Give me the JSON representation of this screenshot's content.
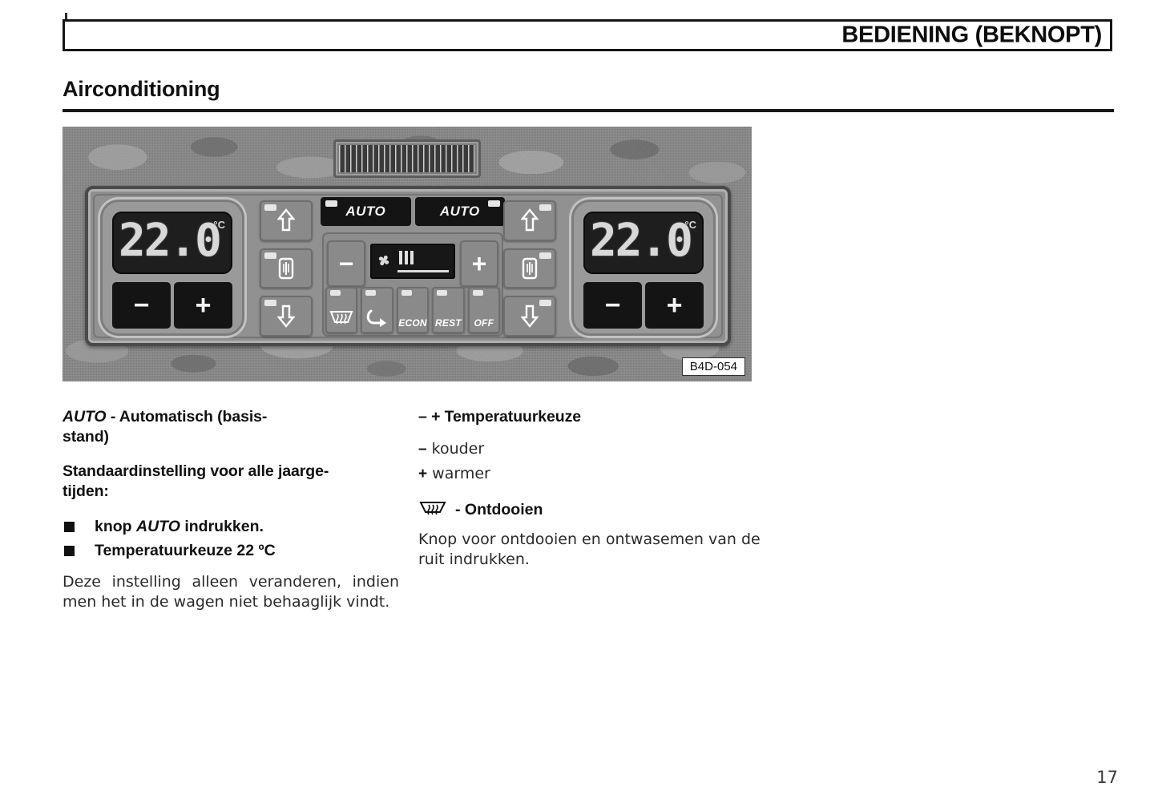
{
  "header": {
    "title": "BEDIENING (BEKNOPT)"
  },
  "section": {
    "title": "Airconditioning"
  },
  "figure": {
    "code": "B4D-054",
    "caption_code_label": "B4D-054",
    "panel": {
      "left_display": {
        "temperature": "22.0",
        "unit": "°C"
      },
      "right_display": {
        "temperature": "22.0",
        "unit": "°C"
      },
      "left_minus": "−",
      "left_plus": "+",
      "right_minus": "−",
      "right_plus": "+",
      "auto_left": "AUTO",
      "auto_right": "AUTO",
      "fan_minus": "−",
      "fan_plus": "+",
      "fan_level_bars": 3,
      "function_buttons": [
        {
          "name": "defrost",
          "label": ""
        },
        {
          "name": "recirculate",
          "label": ""
        },
        {
          "name": "econ",
          "label": "ECON"
        },
        {
          "name": "rest",
          "label": "REST"
        },
        {
          "name": "off",
          "label": "OFF"
        }
      ],
      "airflow_buttons": [
        {
          "name": "upper-vent",
          "label": ""
        },
        {
          "name": "middle-vent",
          "label": ""
        },
        {
          "name": "lower-vent",
          "label": ""
        }
      ]
    }
  },
  "left_column": {
    "heading1_italic": "AUTO",
    "heading1_rest": " - Automatisch (basis-",
    "heading1_line2": "stand)",
    "heading2_line1": "Standaardinstelling voor alle jaarge-",
    "heading2_line2": "tijden:",
    "bullets": [
      {
        "pre": "knop ",
        "italic": "AUTO",
        "post": " indrukken."
      },
      {
        "pre": "Temperatuurkeuze 22 ºC",
        "italic": "",
        "post": ""
      }
    ],
    "paragraph": "Deze instelling alleen veranderen, indien men het in de wagen niet behaaglijk vindt."
  },
  "right_column": {
    "heading1": "– + Temperatuurkeuze",
    "items": [
      {
        "sign": "–",
        "text": "kouder"
      },
      {
        "sign": "+",
        "text": "warmer"
      }
    ],
    "defrost_heading": "- Ontdooien",
    "defrost_paragraph": "Knop voor ontdooien en ontwasemen van de ruit indrukken."
  },
  "footer": {
    "page_number": "17"
  },
  "colors": {
    "ink": "#111111",
    "body_text": "#2a2a2a",
    "panel_bg": "#8e8e8e",
    "lcd_bg": "#1e1e1e",
    "lcd_text": "#d8d8d8"
  }
}
